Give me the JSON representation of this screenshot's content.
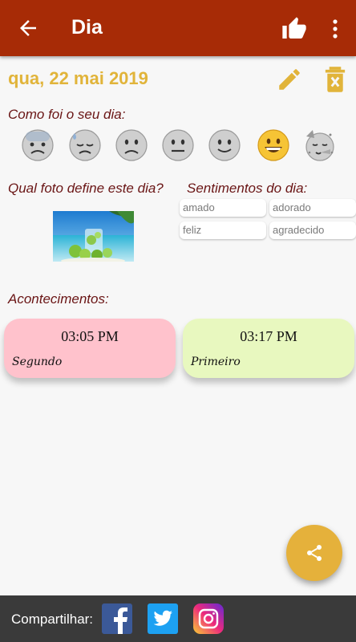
{
  "appbar": {
    "title": "Dia",
    "icons": [
      "arrow-back-icon",
      "thumbs-up-icon",
      "more-vert-icon"
    ]
  },
  "day": {
    "date": "qua, 22 mai 2019",
    "icons": [
      "pencil-icon",
      "delete-icon"
    ]
  },
  "mood": {
    "label": "Como foi o seu dia:",
    "options": [
      "anxious-face",
      "downcast-face",
      "slightly-frowning-face",
      "neutral-face",
      "slightly-smiling-face",
      "grinning-face",
      "partying-face"
    ],
    "selected_index": 5
  },
  "photo": {
    "label": "Qual foto define este dia?"
  },
  "feelings": {
    "label": "Sentimentos do dia:",
    "items": [
      "amado",
      "adorado",
      "feliz",
      "agradecido"
    ]
  },
  "events": {
    "label": "Acontecimentos:",
    "items": [
      {
        "time": "03:05 PM",
        "name": "Segundo",
        "color": "#ffc2cc"
      },
      {
        "time": "03:17 PM",
        "name": "Primeiro",
        "color": "#e8f8bf"
      }
    ]
  },
  "share_fab": {
    "icon": "share-icon"
  },
  "footer": {
    "label": "Compartilhar:",
    "icons": [
      "facebook-icon",
      "twitter-icon",
      "instagram-icon"
    ]
  },
  "colors": {
    "appbar": "#a72b06",
    "accent": "#e1b43a",
    "label": "#6a1515",
    "footer": "#3a3a3a"
  }
}
